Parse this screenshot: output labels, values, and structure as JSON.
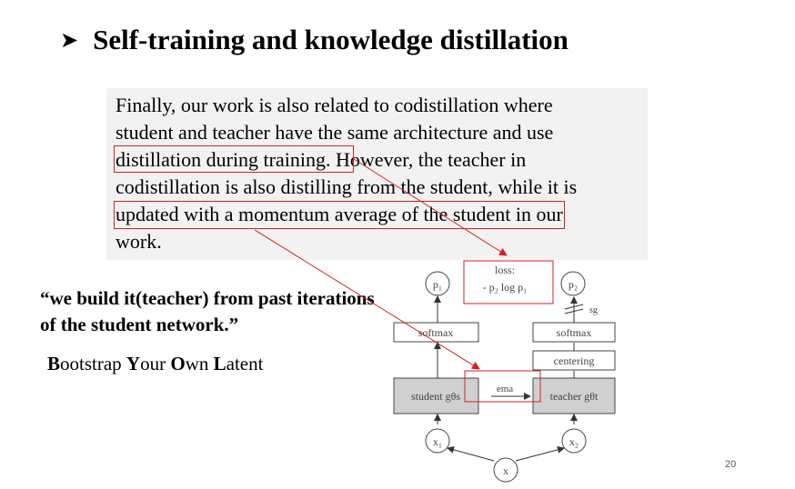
{
  "slide": {
    "title": "Self-training and knowledge distillation",
    "page_number": "20"
  },
  "quote": {
    "lines": [
      "Finally, our work is also related to codistillation  where",
      "student and teacher have the same architecture and use",
      "distillation during training. However, the teacher in",
      "codistillation is also distilling from the student, while it is",
      "updated with a momentum average of the student in our",
      "work."
    ],
    "highlight_1": "distillation during training",
    "highlight_2": "updated with a momentum average of the student"
  },
  "pull_quote": "“we build it(teacher) from past iterations of the student network.”",
  "byol": [
    {
      "initial": "B",
      "rest": "ootstrap "
    },
    {
      "initial": "Y",
      "rest": "our "
    },
    {
      "initial": "O",
      "rest": "wn "
    },
    {
      "initial": "L",
      "rest": "atent"
    }
  ],
  "diagram": {
    "p1": "p₁",
    "p2": "p₂",
    "loss_label": "loss:",
    "loss_formula": "- p₂ log p₁",
    "sg": "sg",
    "softmax_left": "softmax",
    "softmax_right": "softmax",
    "centering": "centering",
    "student": "student gθs",
    "teacher": "teacher gθt",
    "ema": "ema",
    "x1": "x₁",
    "x2": "x₂",
    "x": "x",
    "accent_color": "#d62020"
  }
}
